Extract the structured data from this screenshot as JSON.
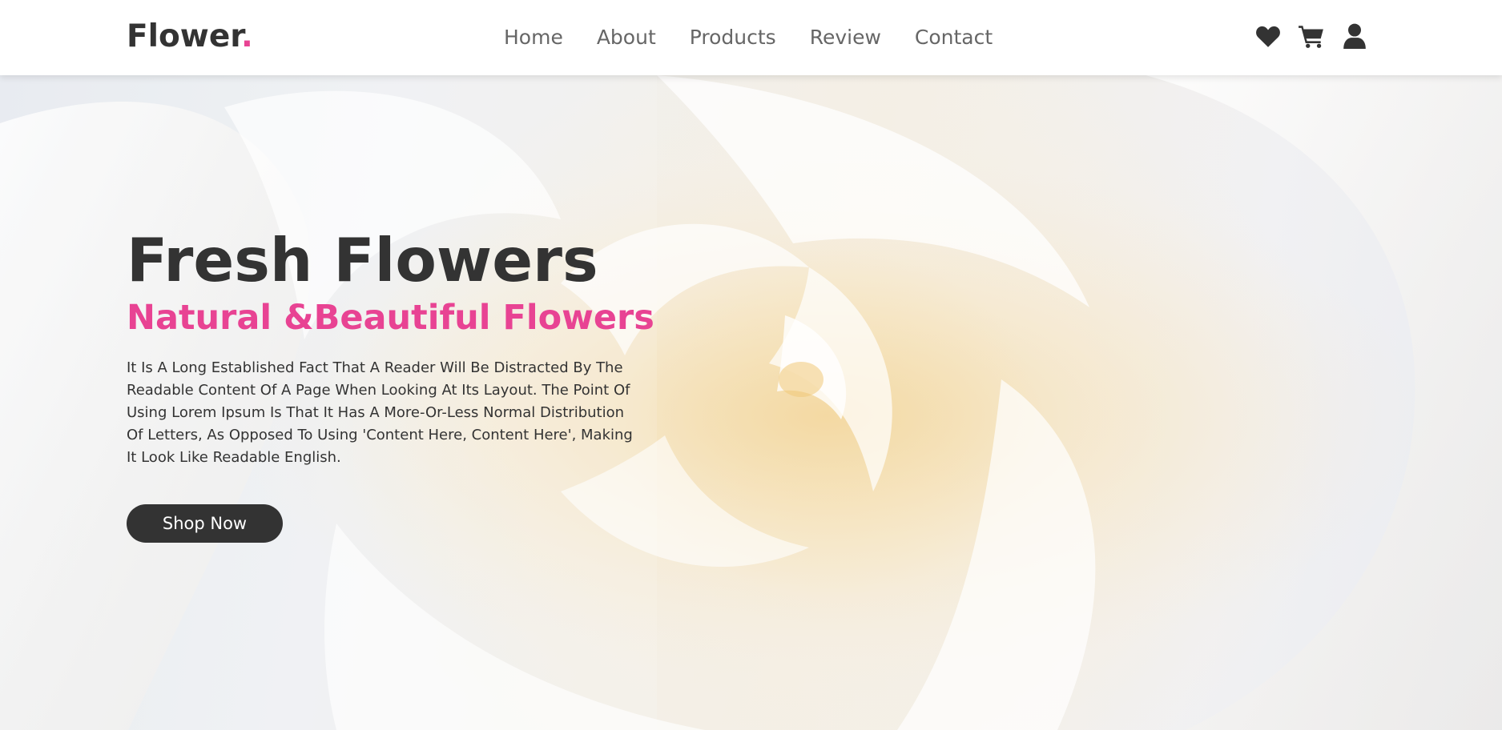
{
  "brand": {
    "name": "Flower",
    "dot": ".",
    "accent_color": "#e84393",
    "text_color": "#333333"
  },
  "nav": {
    "items": [
      "Home",
      "About",
      "Products",
      "Review",
      "Contact"
    ]
  },
  "header_icons": [
    "heart-icon",
    "cart-icon",
    "user-icon"
  ],
  "hero": {
    "title": "Fresh Flowers",
    "subtitle": "Natural &Beautiful Flowers",
    "description": "It Is A Long Established Fact That A Reader Will Be Distracted By The Readable Content Of A Page When Looking At Its Layout. The Point Of Using Lorem Ipsum Is That It Has A More-Or-Less Normal Distribution Of Letters, As Opposed To Using 'Content Here, Content Here', Making It Look Like Readable English.",
    "button_label": "Shop Now",
    "background_image": "white rose close-up"
  }
}
